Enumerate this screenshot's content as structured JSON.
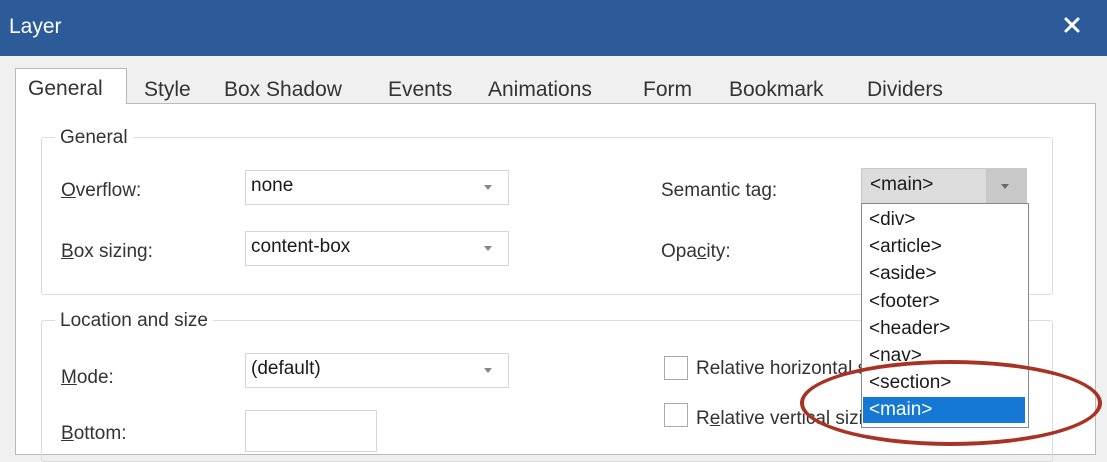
{
  "window": {
    "title": "Layer",
    "close_icon": "close-icon"
  },
  "tabs": [
    {
      "label": "General",
      "active": true
    },
    {
      "label": "Style"
    },
    {
      "label": "Box Shadow"
    },
    {
      "label": "Events"
    },
    {
      "label": "Animations"
    },
    {
      "label": "Form"
    },
    {
      "label": "Bookmark"
    },
    {
      "label": "Dividers"
    }
  ],
  "general": {
    "legend": "General",
    "overflow": {
      "label_u": "O",
      "label_rest": "verflow:",
      "value": "none"
    },
    "box_sizing": {
      "label_u": "B",
      "label_rest": "ox sizing:",
      "value": "content-box"
    },
    "semantic_tag": {
      "label": "Semantic tag:",
      "value": "<main>"
    },
    "opacity": {
      "label_pre": "Opa",
      "label_u": "c",
      "label_rest": "ity:"
    }
  },
  "location": {
    "legend": "Location and size",
    "mode": {
      "label_u": "M",
      "label_rest": "ode:",
      "value": "(default)"
    },
    "bottom": {
      "label_u": "B",
      "label_rest": "ottom:"
    },
    "rel_horizontal": {
      "label": "Relative horizontal sizing"
    },
    "rel_vertical": {
      "label_pre": "R",
      "label_u": "e",
      "label_rest": "lative vertical sizing"
    }
  },
  "semantic_options": [
    "<div>",
    "<article>",
    "<aside>",
    "<footer>",
    "<header>",
    "<nav>",
    "<section>",
    "<main>"
  ],
  "selected_option": "<main>",
  "colors": {
    "titlebar": "#2d5b9a",
    "highlight": "#1478d4",
    "annotation": "#a83224"
  }
}
